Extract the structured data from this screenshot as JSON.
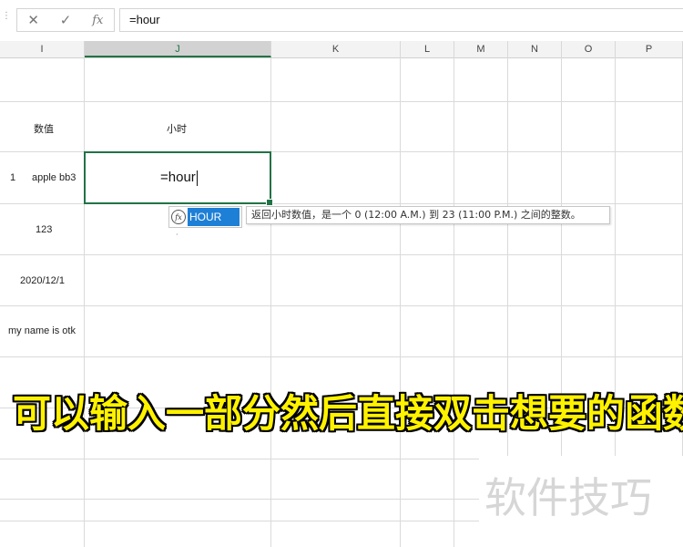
{
  "formula_bar": {
    "cancel_icon": "✕",
    "enter_icon": "✓",
    "fx_label": "fx",
    "value": "=hour"
  },
  "columns": [
    "I",
    "J",
    "K",
    "L",
    "M",
    "N",
    "O",
    "P"
  ],
  "active_column": "J",
  "cells": {
    "i_header": "数值",
    "j_header": "小时",
    "i_row2_num": "1",
    "i_row2_text": "apple bb3",
    "i_row3": "123",
    "i_row4": "2020/12/1",
    "i_row5": "my name is otk"
  },
  "active_cell": {
    "text": "=hour"
  },
  "autocomplete": {
    "icon_label": "fx",
    "item": "HOUR",
    "tooltip": "返回小时数值，是一个 0 (12:00 A.M.) 到 23 (11:00 P.M.) 之间的整数。"
  },
  "caption": "可以输入一部分然后直接双击想要的函数",
  "watermark": "软件技巧"
}
